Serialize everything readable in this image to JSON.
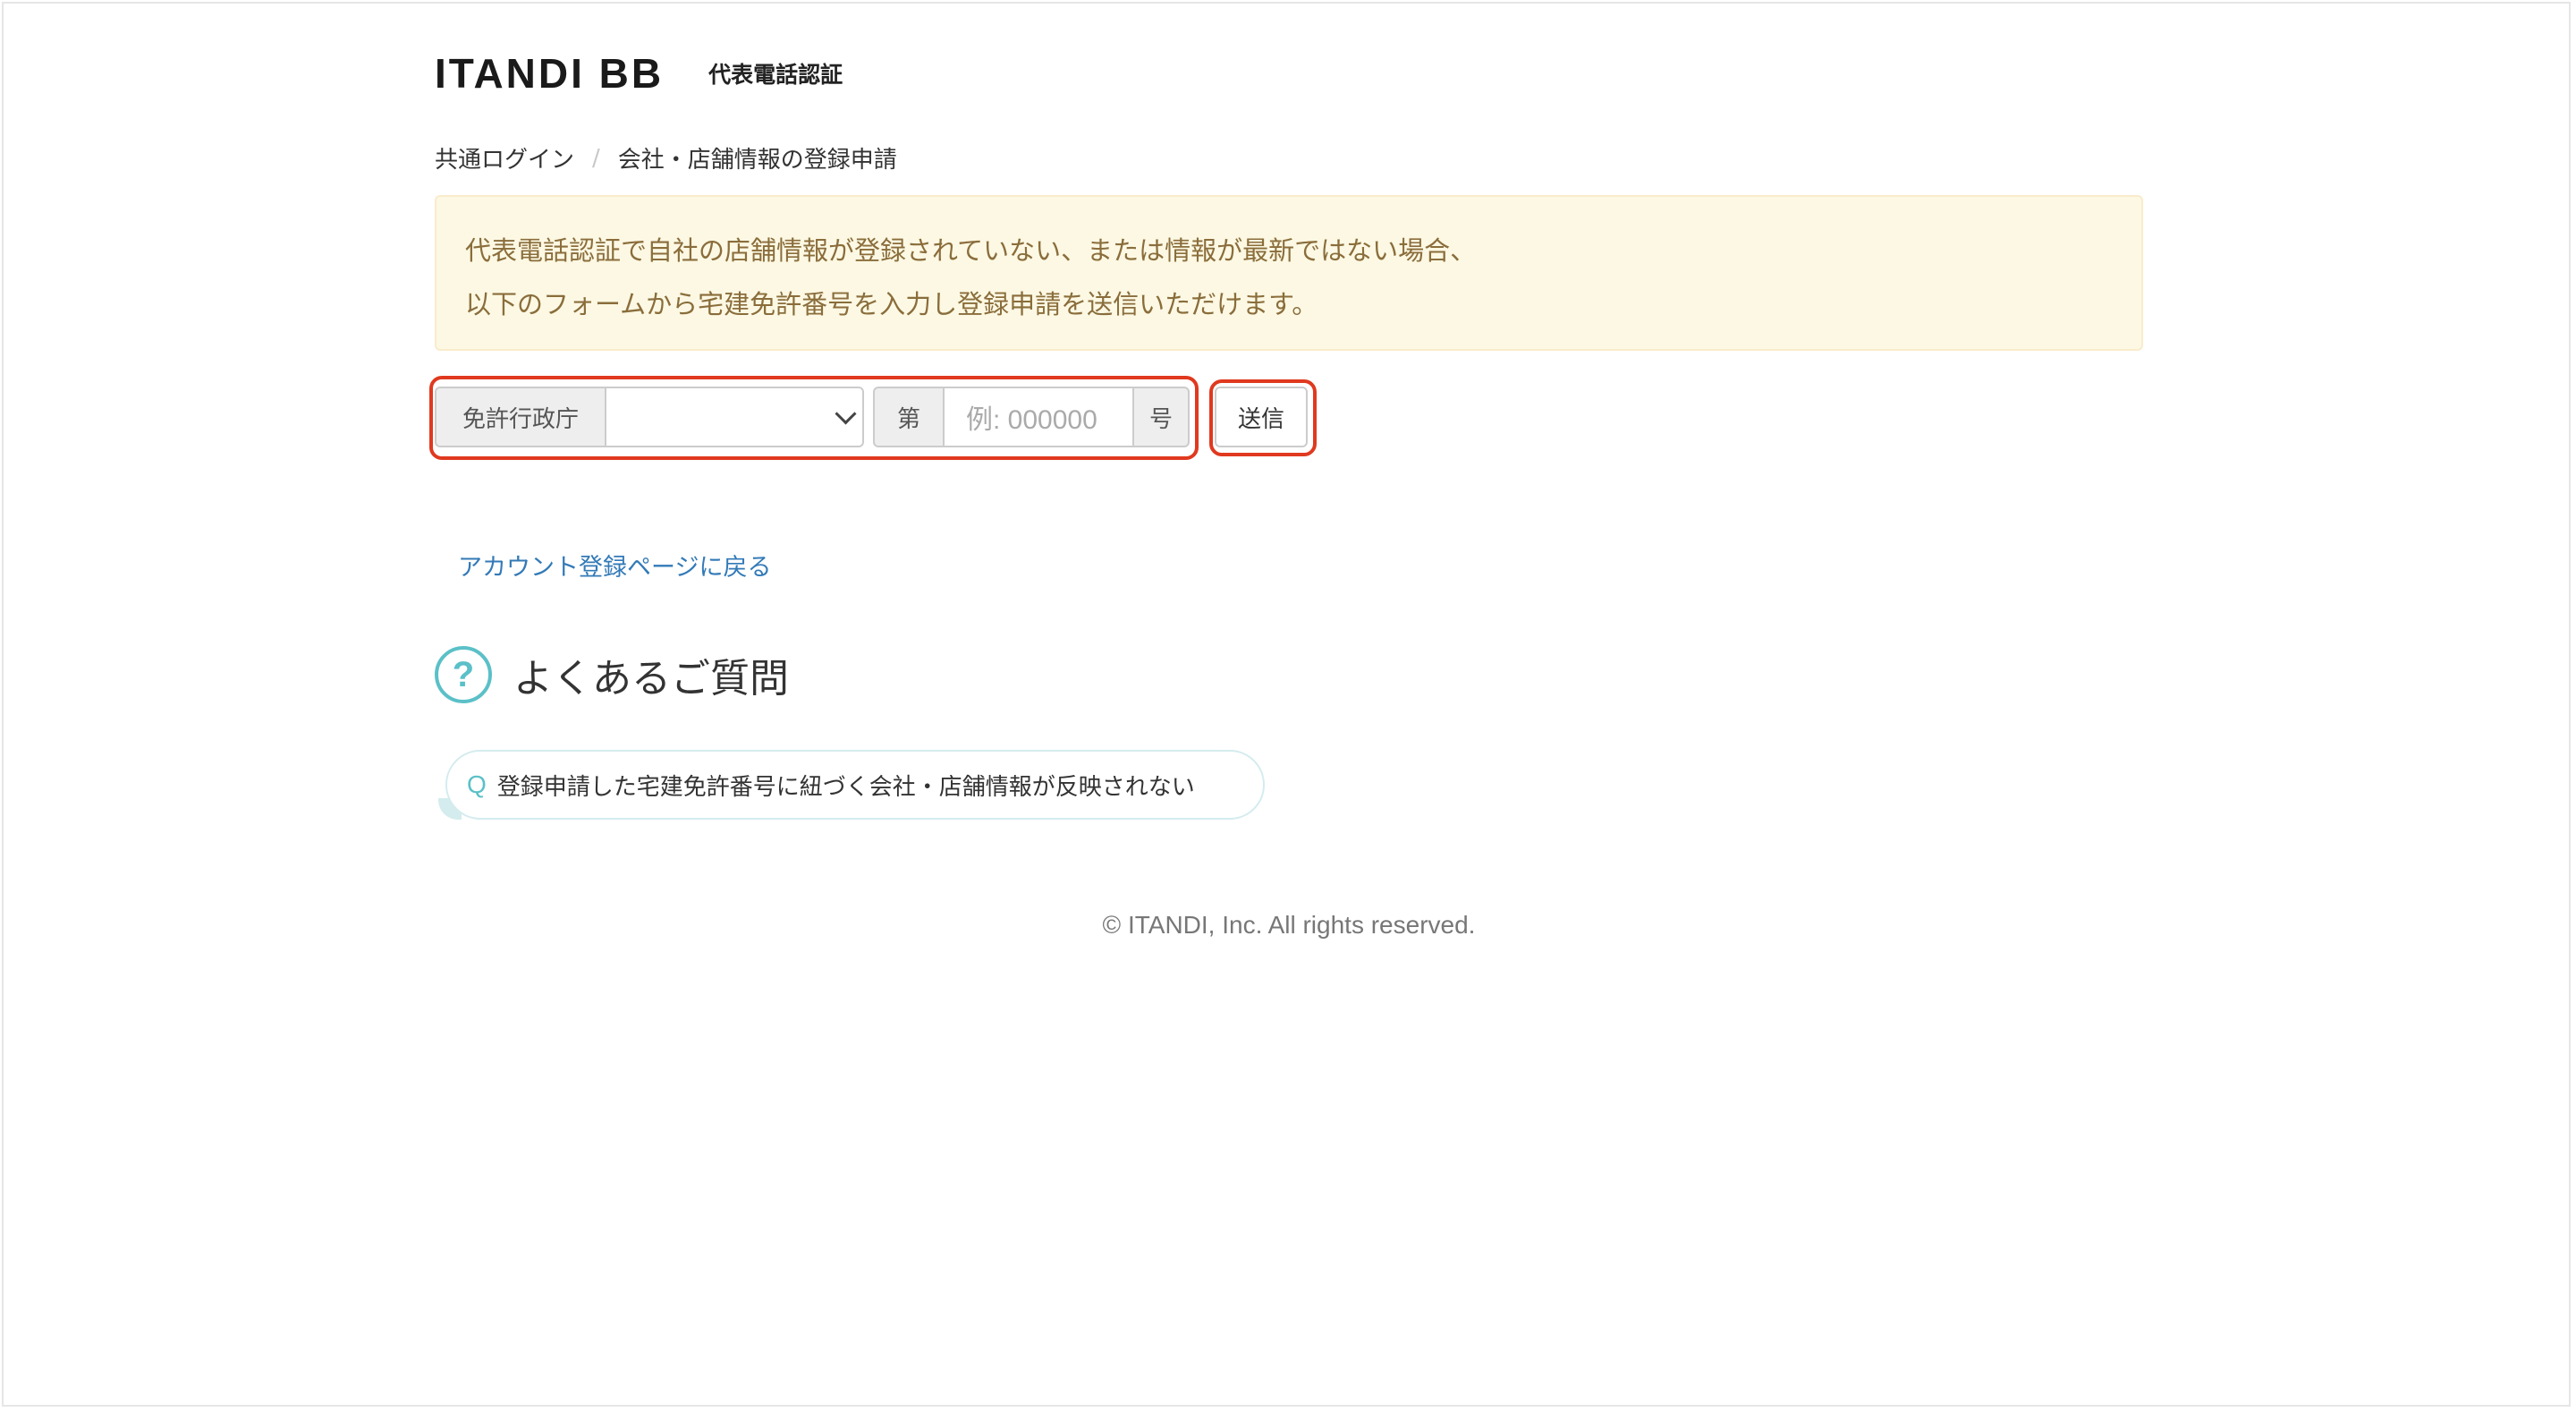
{
  "header": {
    "logo": "ITANDI BB",
    "title": "代表電話認証"
  },
  "breadcrumb": {
    "items": [
      "共通ログイン",
      "会社・店舗情報の登録申請"
    ],
    "separator": "/"
  },
  "notice": {
    "lines": [
      "代表電話認証で自社の店舗情報が登録されていない、または情報が最新ではない場合、",
      "以下のフォームから宅建免許番号を入力し登録申請を送信いただけます。"
    ]
  },
  "form": {
    "authority_label": "免許行政庁",
    "authority_selected": "",
    "prefix_label": "第",
    "number_placeholder": "例: 000000",
    "suffix_label": "号",
    "submit_label": "送信"
  },
  "links": {
    "back": "アカウント登録ページに戻る"
  },
  "faq": {
    "icon": "question-circle-icon",
    "title": "よくあるご質問",
    "items": [
      {
        "q": "Q",
        "text": "登録申請した宅建免許番号に紐づく会社・店舗情報が反映されない"
      }
    ]
  },
  "footer": {
    "copyright": "© ITANDI, Inc. All rights reserved."
  },
  "colors": {
    "highlight": "#e0391f",
    "notice_bg": "#fcf8e3",
    "notice_text": "#8a6d3b",
    "link": "#337ab7",
    "faq_accent": "#5bc0c8"
  }
}
